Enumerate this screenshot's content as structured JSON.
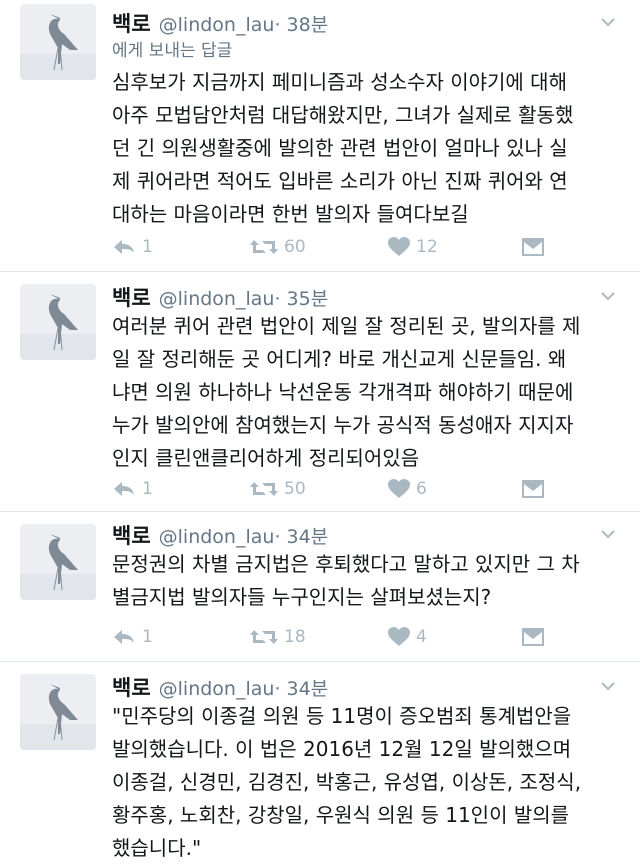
{
  "accent": "#aab8c2",
  "tweets": [
    {
      "name": "백로",
      "handle": "@lindon_lau",
      "time": "· 38분",
      "reply_label": "에게 보내는 답글",
      "lines": [
        "심후보가 지금까지 페미니즘과 성소수자 이야기에 대해",
        "아주 모법담안처럼 대답해왔지만, 그녀가 실제로 활동했",
        "던 긴 의원생활중에 발의한 관련 법안이 얼마나 있나 실",
        "제 퀴어라면 적어도 입바른 소리가 아닌 진짜 퀴어와 연",
        "대하는 마음이라면 한번 발의자 들여다보길"
      ],
      "replies": "1",
      "retweets": "60",
      "likes": "12"
    },
    {
      "name": "백로",
      "handle": "@lindon_lau",
      "time": "· 35분",
      "lines": [
        "여러분 퀴어 관련 법안이 제일 잘 정리된 곳, 발의자를 제",
        "일 잘 정리해둔 곳 어디게? 바로 개신교게 신문들임. 왜",
        "냐면 의원 하나하나 낙선운동 각개격파 해야하기 때문에",
        "누가 발의안에 참여했는지 누가 공식적 동성애자 지지자",
        "인지 클린앤클리어하게 정리되어있음"
      ],
      "replies": "1",
      "retweets": "50",
      "likes": "6"
    },
    {
      "name": "백로",
      "handle": "@lindon_lau",
      "time": "· 34분",
      "lines": [
        "문정권의 차별 금지법은 후퇴했다고 말하고 있지만 그 차",
        "별금지법 발의자들 누구인지는 살펴보셨는지?"
      ],
      "replies": "1",
      "retweets": "18",
      "likes": "4"
    },
    {
      "name": "백로",
      "handle": "@lindon_lau",
      "time": "· 34분",
      "lines": [
        "\"민주당의 이종걸 의원 등 11명이 증오범죄 통계법안을",
        "발의했습니다. 이 법은 2016년 12월 12일 발의했으며",
        "이종걸, 신경민, 김경진, 박홍근, 유성엽, 이상돈, 조정식,",
        "황주홍, 노회찬, 강창일, 우원식 의원 등 11인이 발의를",
        "했습니다.\""
      ]
    }
  ]
}
